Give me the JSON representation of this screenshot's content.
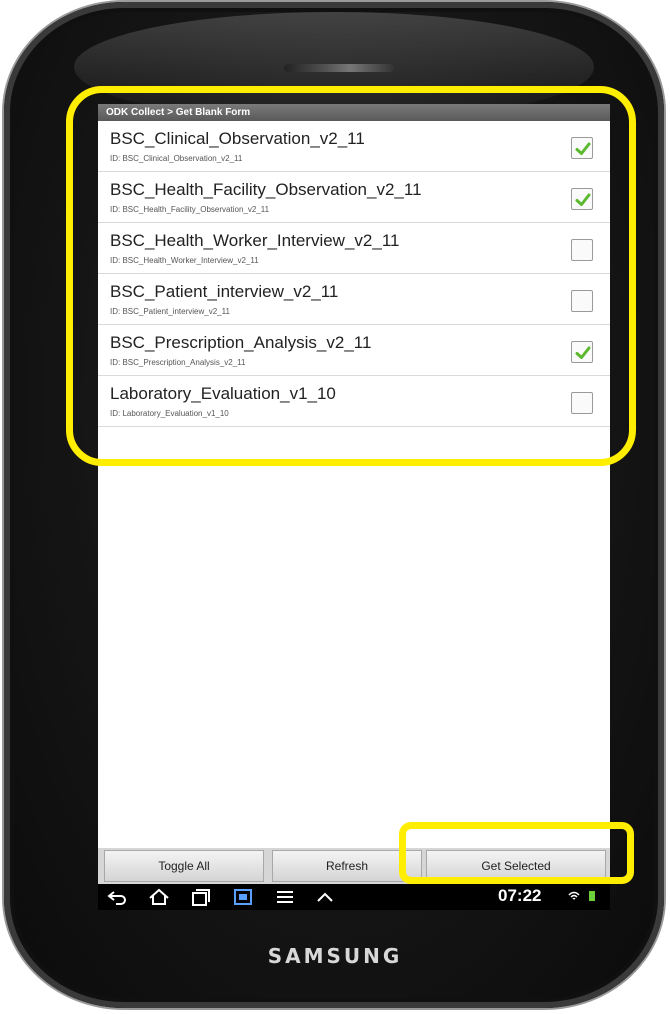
{
  "app": {
    "title": "ODK Collect > Get Blank Form"
  },
  "forms": [
    {
      "name": "BSC_Clinical_Observation_v2_11",
      "id": "ID: BSC_Clinical_Observation_v2_11",
      "checked": true
    },
    {
      "name": "BSC_Health_Facility_Observation_v2_11",
      "id": "ID: BSC_Health_Facility_Observation_v2_11",
      "checked": true
    },
    {
      "name": "BSC_Health_Worker_Interview_v2_11",
      "id": "ID: BSC_Health_Worker_Interview_v2_11",
      "checked": false
    },
    {
      "name": "BSC_Patient_interview_v2_11",
      "id": "ID: BSC_Patient_interview_v2_11",
      "checked": false
    },
    {
      "name": "BSC_Prescription_Analysis_v2_11",
      "id": "ID: BSC_Prescription_Analysis_v2_11",
      "checked": true
    },
    {
      "name": "Laboratory_Evaluation_v1_10",
      "id": "ID: Laboratory_Evaluation_v1_10",
      "checked": false
    }
  ],
  "buttons": {
    "toggle_all": "Toggle All",
    "refresh": "Refresh",
    "get_selected": "Get Selected"
  },
  "status": {
    "clock": "07:22"
  },
  "device": {
    "brand": "SAMSUNG"
  },
  "colors": {
    "highlight": "#ffee00",
    "check": "#5cb82e"
  },
  "icons": [
    "back-icon",
    "home-icon",
    "recent-apps-icon",
    "screenshot-icon",
    "menu-icon",
    "up-icon",
    "wifi-icon",
    "battery-icon"
  ]
}
